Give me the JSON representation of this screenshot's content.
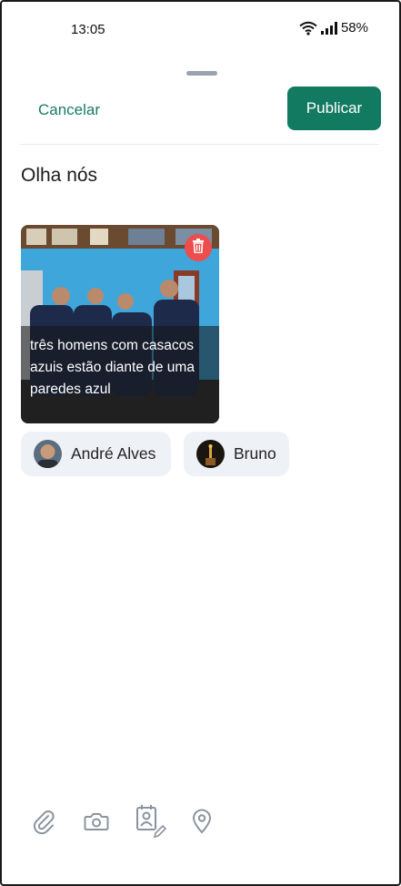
{
  "status_bar": {
    "time": "13:05",
    "battery": "58%",
    "icons": [
      "wifi-icon",
      "signal-icon"
    ]
  },
  "header": {
    "cancel_label": "Cancelar",
    "publish_label": "Publicar"
  },
  "post": {
    "text": "Olha nós"
  },
  "attachment": {
    "caption": "três homens com casacos azuis estão diante de uma paredes azul",
    "delete_icon": "trash-icon"
  },
  "tagged_people": [
    {
      "name": "André Alves"
    },
    {
      "name": "Bruno"
    }
  ],
  "toolbar": {
    "icons": [
      "paperclip-icon",
      "camera-icon",
      "contact-card-edit-icon",
      "location-pin-icon"
    ]
  },
  "colors": {
    "accent": "#137a62",
    "link": "#1a7a63",
    "delete": "#ee4d4d",
    "chip_bg": "#eef1f5"
  }
}
